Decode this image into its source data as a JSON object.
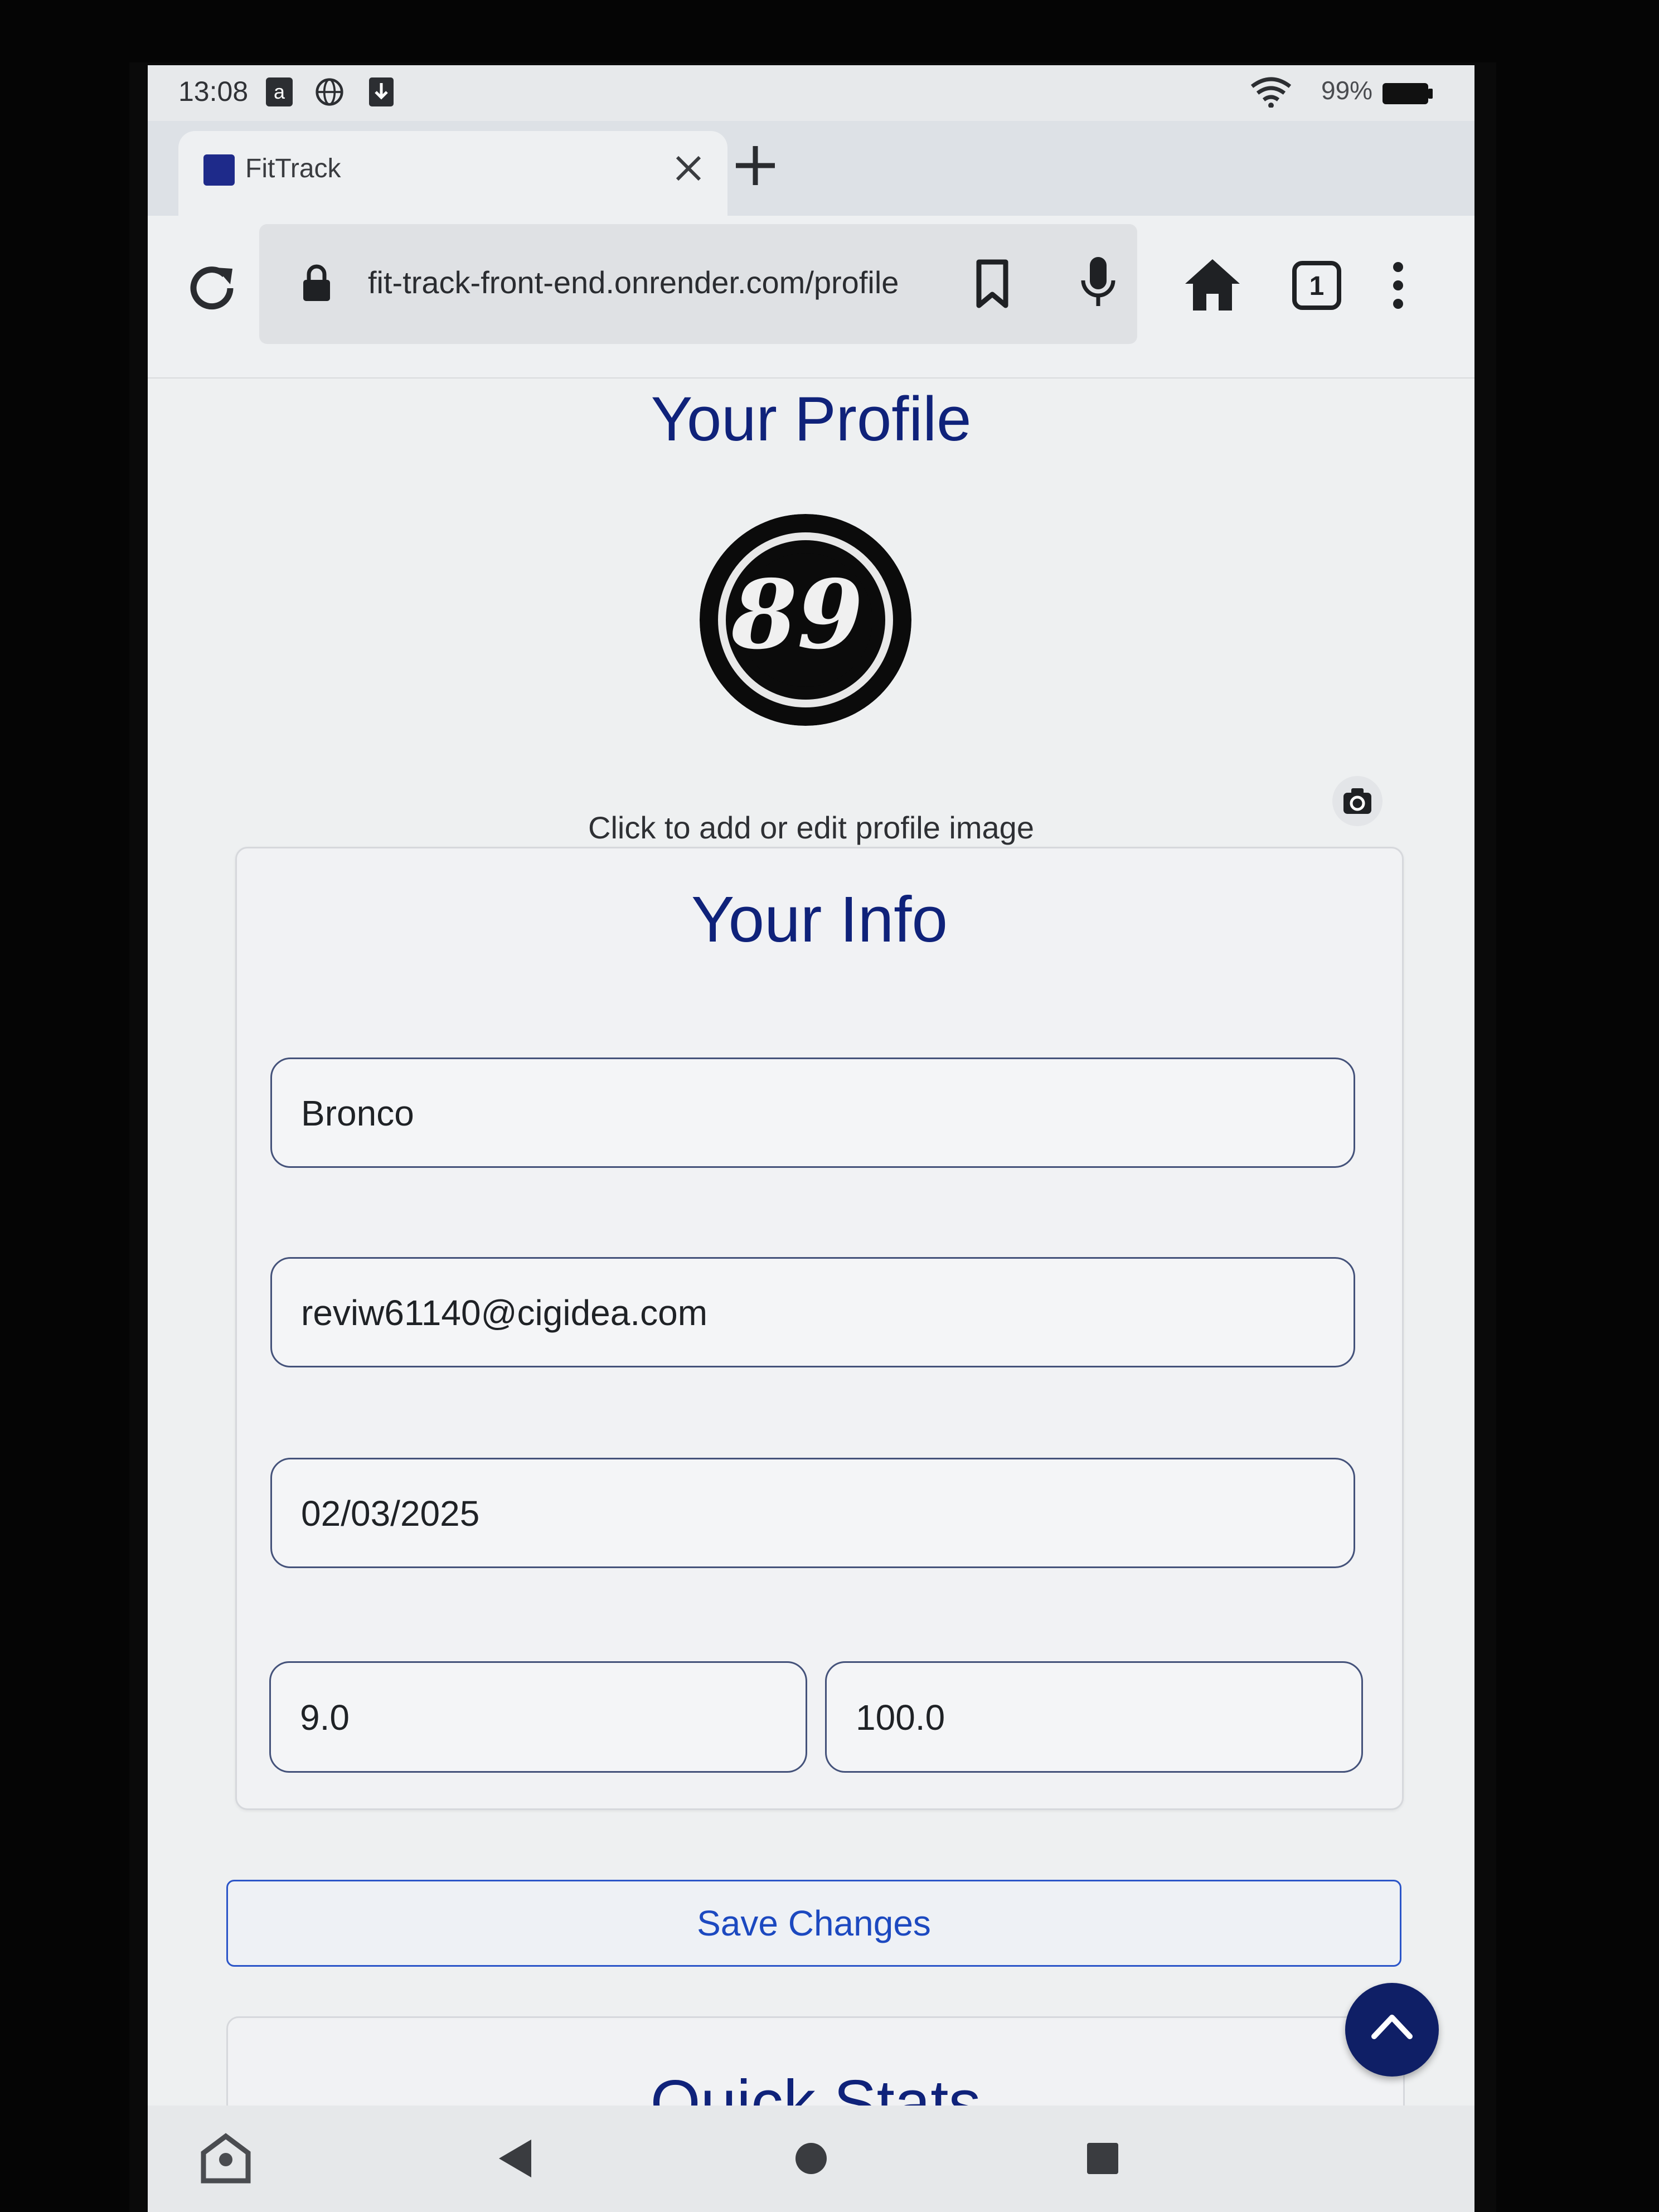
{
  "status_bar": {
    "time": "13:08",
    "battery": "99%",
    "icons": [
      "amazon-icon",
      "globe-icon",
      "download-icon",
      "wifi-icon",
      "battery-icon"
    ]
  },
  "browser": {
    "tab_title": "FitTrack",
    "url": "fit-track-front-end.onrender.com/profile",
    "tab_count": "1"
  },
  "profile": {
    "heading": "Your Profile",
    "image_hint": "Click to add or edit profile image"
  },
  "info": {
    "heading": "Your Info",
    "name": "Bronco",
    "email": "reviw61140@cigidea.com",
    "date": "02/03/2025",
    "value_left": "9.0",
    "value_right": "100.0"
  },
  "actions": {
    "save_label": "Save Changes"
  },
  "quick_stats": {
    "heading": "Quick Stats"
  },
  "colors": {
    "heading": "#0f227a",
    "button_text": "#1c49c0",
    "fab": "#0f1f66"
  }
}
